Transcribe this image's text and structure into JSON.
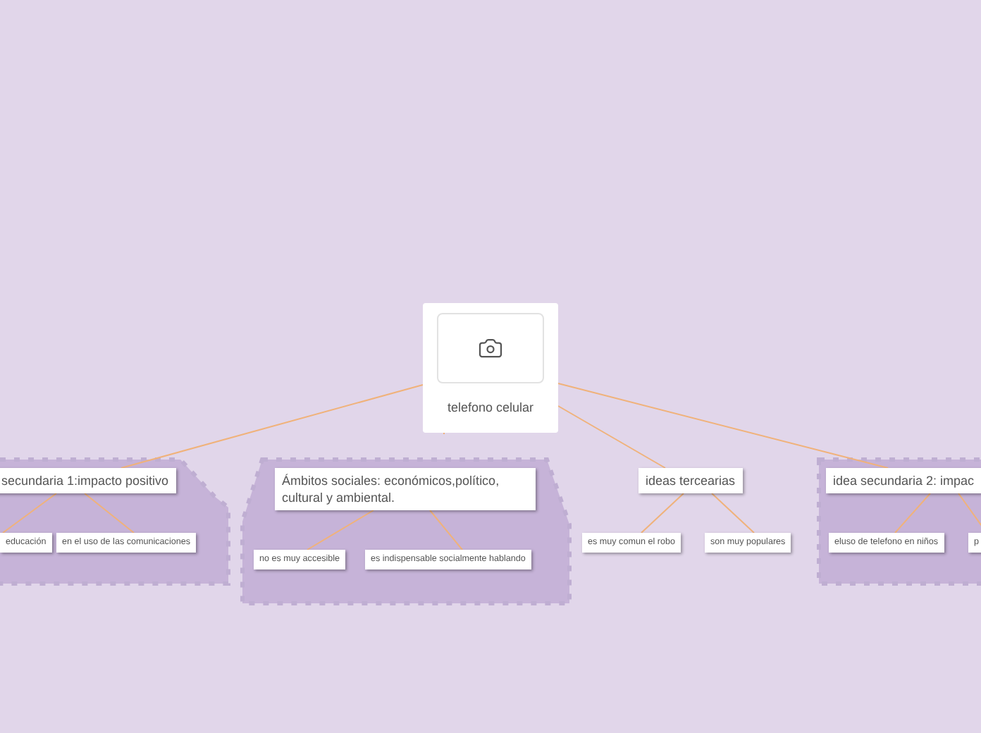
{
  "root": {
    "label": "telefono celular"
  },
  "branches": [
    {
      "label": "secundaria 1:impacto positivo",
      "grouped": true,
      "children": [
        {
          "label": "educación"
        },
        {
          "label": "en el uso de las comunicaciones"
        }
      ]
    },
    {
      "label": "Ámbitos sociales: económicos,político, cultural y ambiental.",
      "grouped": true,
      "children": [
        {
          "label": "no es muy accesible"
        },
        {
          "label": "es indispensable socialmente hablando"
        }
      ]
    },
    {
      "label": "ideas tercearias",
      "grouped": false,
      "children": [
        {
          "label": "es muy comun el robo"
        },
        {
          "label": "son muy populares"
        }
      ]
    },
    {
      "label": "idea secundaria 2: impac",
      "grouped": true,
      "children": [
        {
          "label": "eluso de telefono en niños"
        },
        {
          "label": "p"
        }
      ]
    }
  ]
}
